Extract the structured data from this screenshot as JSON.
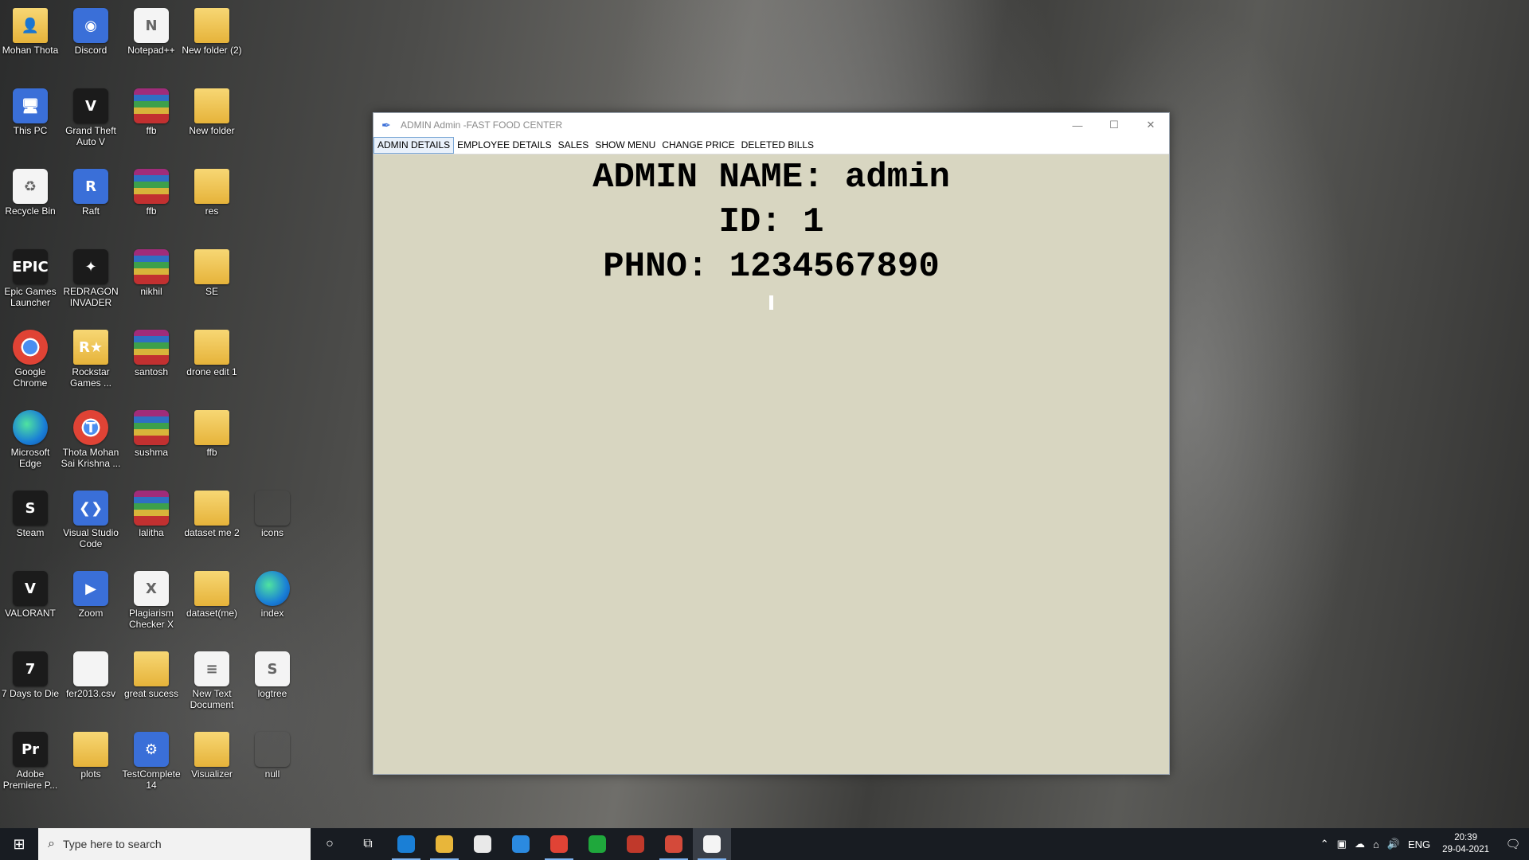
{
  "desktop": {
    "icons": [
      {
        "label": "Mohan Thota",
        "glyph": "👤",
        "style": "ic-folder",
        "icon": "user-folder-icon"
      },
      {
        "label": "Discord",
        "glyph": "◉",
        "style": "ic-blue",
        "icon": "discord-icon"
      },
      {
        "label": "Notepad++",
        "glyph": "N",
        "style": "ic-file",
        "icon": "notepad-plus-plus-icon"
      },
      {
        "label": "New folder (2)",
        "glyph": "",
        "style": "ic-folder",
        "icon": "folder-icon"
      },
      {
        "label": "This PC",
        "glyph": "🖥",
        "style": "ic-blue",
        "icon": "computer-icon"
      },
      {
        "label": "Grand Theft Auto V",
        "glyph": "V",
        "style": "ic-dark",
        "icon": "gta-v-icon"
      },
      {
        "label": "ffb",
        "glyph": "",
        "style": "ic-rar",
        "icon": "winrar-archive-icon"
      },
      {
        "label": "New folder",
        "glyph": "",
        "style": "ic-folder",
        "icon": "folder-icon"
      },
      {
        "label": "Recycle Bin",
        "glyph": "♻",
        "style": "ic-file",
        "icon": "recycle-bin-icon"
      },
      {
        "label": "Raft",
        "glyph": "R",
        "style": "ic-blue",
        "icon": "raft-icon"
      },
      {
        "label": "ffb",
        "glyph": "",
        "style": "ic-rar",
        "icon": "winrar-archive-icon"
      },
      {
        "label": "res",
        "glyph": "",
        "style": "ic-folder",
        "icon": "folder-icon"
      },
      {
        "label": "Epic Games Launcher",
        "glyph": "EPIC",
        "style": "ic-dark",
        "icon": "epic-games-icon"
      },
      {
        "label": "REDRAGON INVADER",
        "glyph": "✦",
        "style": "ic-dark",
        "icon": "redragon-icon"
      },
      {
        "label": "nikhil",
        "glyph": "",
        "style": "ic-rar",
        "icon": "winrar-archive-icon"
      },
      {
        "label": "SE",
        "glyph": "",
        "style": "ic-folder",
        "icon": "folder-icon"
      },
      {
        "label": "Google Chrome",
        "glyph": "",
        "style": "ic-chrome",
        "icon": "chrome-icon"
      },
      {
        "label": "Rockstar Games ...",
        "glyph": "R★",
        "style": "ic-folder",
        "icon": "rockstar-games-icon"
      },
      {
        "label": "santosh",
        "glyph": "",
        "style": "ic-rar",
        "icon": "winrar-archive-icon"
      },
      {
        "label": "drone edit 1",
        "glyph": "",
        "style": "ic-folder",
        "icon": "folder-icon"
      },
      {
        "label": "Microsoft Edge",
        "glyph": "",
        "style": "ic-edge",
        "icon": "edge-icon"
      },
      {
        "label": "Thota Mohan Sai Krishna ...",
        "glyph": "T",
        "style": "ic-chrome",
        "icon": "chrome-profile-icon"
      },
      {
        "label": "sushma",
        "glyph": "",
        "style": "ic-rar",
        "icon": "winrar-archive-icon"
      },
      {
        "label": "ffb",
        "glyph": "",
        "style": "ic-folder",
        "icon": "folder-icon"
      },
      {
        "label": "Steam",
        "glyph": "S",
        "style": "ic-dark",
        "icon": "steam-icon"
      },
      {
        "label": "Visual Studio Code",
        "glyph": "❮❯",
        "style": "ic-blue",
        "icon": "vscode-icon"
      },
      {
        "label": "lalitha",
        "glyph": "",
        "style": "ic-rar",
        "icon": "winrar-archive-icon"
      },
      {
        "label": "dataset me 2",
        "glyph": "",
        "style": "ic-folder",
        "icon": "folder-icon"
      },
      {
        "label": "icons",
        "glyph": "",
        "style": "",
        "icon": "folder-icon"
      },
      {
        "label": "VALORANT",
        "glyph": "V",
        "style": "ic-dark",
        "icon": "valorant-icon"
      },
      {
        "label": "Zoom",
        "glyph": "▶",
        "style": "ic-blue",
        "icon": "zoom-icon"
      },
      {
        "label": "Plagiarism Checker X",
        "glyph": "X",
        "style": "ic-file",
        "icon": "plagiarism-checker-icon"
      },
      {
        "label": "dataset(me)",
        "glyph": "",
        "style": "ic-folder",
        "icon": "folder-icon"
      },
      {
        "label": "index",
        "glyph": "",
        "style": "ic-edge",
        "icon": "edge-html-icon"
      },
      {
        "label": "7 Days to Die",
        "glyph": "7",
        "style": "ic-dark",
        "icon": "7-days-to-die-icon"
      },
      {
        "label": "fer2013.csv",
        "glyph": "",
        "style": "ic-file",
        "icon": "csv-file-icon"
      },
      {
        "label": "great sucess",
        "glyph": "",
        "style": "ic-folder",
        "icon": "folder-icon"
      },
      {
        "label": "New Text Document",
        "glyph": "≡",
        "style": "ic-file",
        "icon": "text-document-icon"
      },
      {
        "label": "logtree",
        "glyph": "S",
        "style": "ic-file",
        "icon": "python-file-icon"
      },
      {
        "label": "Adobe Premiere P...",
        "glyph": "Pr",
        "style": "ic-dark",
        "icon": "premiere-pro-icon"
      },
      {
        "label": "plots",
        "glyph": "",
        "style": "ic-folder",
        "icon": "folder-icon"
      },
      {
        "label": "TestComplete 14",
        "glyph": "⚙",
        "style": "ic-blue",
        "icon": "testcomplete-icon"
      },
      {
        "label": "Visualizer",
        "glyph": "",
        "style": "ic-folder",
        "icon": "folder-icon"
      },
      {
        "label": "null",
        "glyph": "",
        "style": "",
        "icon": "folder-icon"
      }
    ]
  },
  "window": {
    "title": "ADMIN Admin -FAST FOOD CENTER",
    "controls": {
      "minimize": "—",
      "maximize": "☐",
      "close": "✕"
    },
    "menu": [
      "ADMIN DETAILS",
      "EMPLOYEE DETAILS",
      "SALES",
      "SHOW MENU",
      "CHANGE PRICE",
      "DELETED BILLS"
    ],
    "admin": {
      "name_line": "ADMIN NAME: admin",
      "id_line": "ID: 1",
      "phone_line": "PHNO: 1234567890"
    }
  },
  "taskbar": {
    "search_placeholder": "Type here to search",
    "apps": [
      {
        "icon": "edge-icon",
        "color": "#1a7fd6"
      },
      {
        "icon": "file-explorer-icon",
        "color": "#e8b63a"
      },
      {
        "icon": "store-icon",
        "color": "#e9e9e9"
      },
      {
        "icon": "mail-icon",
        "color": "#2b8ae0"
      },
      {
        "icon": "chrome-icon",
        "color": "#e04335"
      },
      {
        "icon": "green-app-icon",
        "color": "#1fa83c"
      },
      {
        "icon": "gear-app-icon",
        "color": "#c0392b"
      },
      {
        "icon": "chrome-profile-icon",
        "color": "#d44a3a"
      },
      {
        "icon": "python-tk-window-icon",
        "color": "#f4f4f4"
      }
    ],
    "tray": {
      "language": "ENG",
      "time": "20:39",
      "date": "29-04-2021"
    }
  }
}
